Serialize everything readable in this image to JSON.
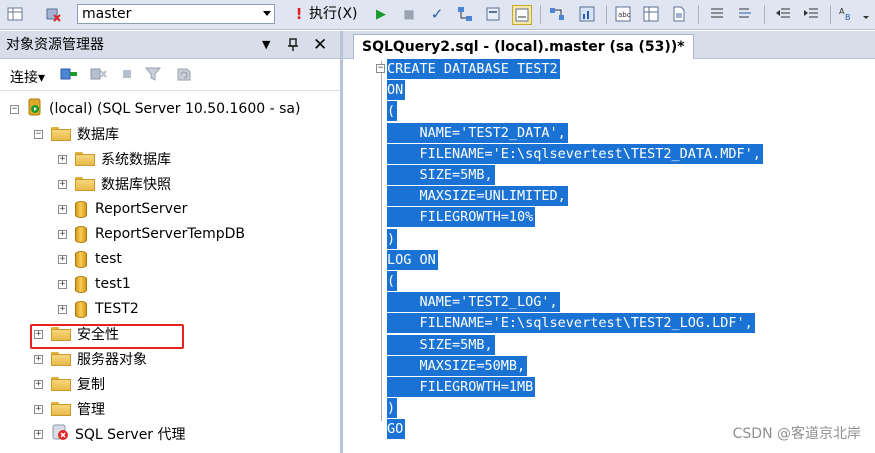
{
  "toolbar": {
    "database": "master",
    "execute_label": "执行(X)"
  },
  "explorer": {
    "title": "对象资源管理器",
    "pin_glyph": "▼",
    "autohide_glyph": "Ⲷ",
    "close_glyph": "✕",
    "connect_label": "连接▾",
    "tree": [
      {
        "label": "(local) (SQL Server 10.50.1600 - sa)",
        "kind": "server",
        "expander": "−"
      },
      {
        "label": "数据库",
        "kind": "folder",
        "expander": "−"
      },
      {
        "label": "系统数据库",
        "kind": "folder",
        "expander": "+"
      },
      {
        "label": "数据库快照",
        "kind": "folder",
        "expander": "+"
      },
      {
        "label": "ReportServer",
        "kind": "db",
        "expander": "+"
      },
      {
        "label": "ReportServerTempDB",
        "kind": "db",
        "expander": "+"
      },
      {
        "label": "test",
        "kind": "db",
        "expander": "+"
      },
      {
        "label": "test1",
        "kind": "db",
        "expander": "+"
      },
      {
        "label": "TEST2",
        "kind": "db",
        "expander": "+"
      },
      {
        "label": "安全性",
        "kind": "folder",
        "expander": "+"
      },
      {
        "label": "服务器对象",
        "kind": "folder",
        "expander": "+"
      },
      {
        "label": "复制",
        "kind": "folder",
        "expander": "+"
      },
      {
        "label": "管理",
        "kind": "folder",
        "expander": "+"
      },
      {
        "label": "SQL Server 代理",
        "kind": "agent",
        "expander": "+"
      }
    ]
  },
  "editor": {
    "tab_title": "SQLQuery2.sql - (local).master (sa (53))*",
    "code": [
      "CREATE DATABASE TEST2",
      "ON",
      "(",
      "    NAME='TEST2_DATA',",
      "    FILENAME='E:\\sqlsevertest\\TEST2_DATA.MDF',",
      "    SIZE=5MB,",
      "    MAXSIZE=UNLIMITED,",
      "    FILEGROWTH=10%",
      ")",
      "LOG ON",
      "(",
      "    NAME='TEST2_LOG',",
      "    FILENAME='E:\\sqlsevertest\\TEST2_LOG.LDF',",
      "    SIZE=5MB,",
      "    MAXSIZE=50MB,",
      "    FILEGROWTH=1MB",
      ")",
      "GO"
    ],
    "selection_color": "#1a73d4"
  },
  "watermark": "CSDN @客道京北岸"
}
